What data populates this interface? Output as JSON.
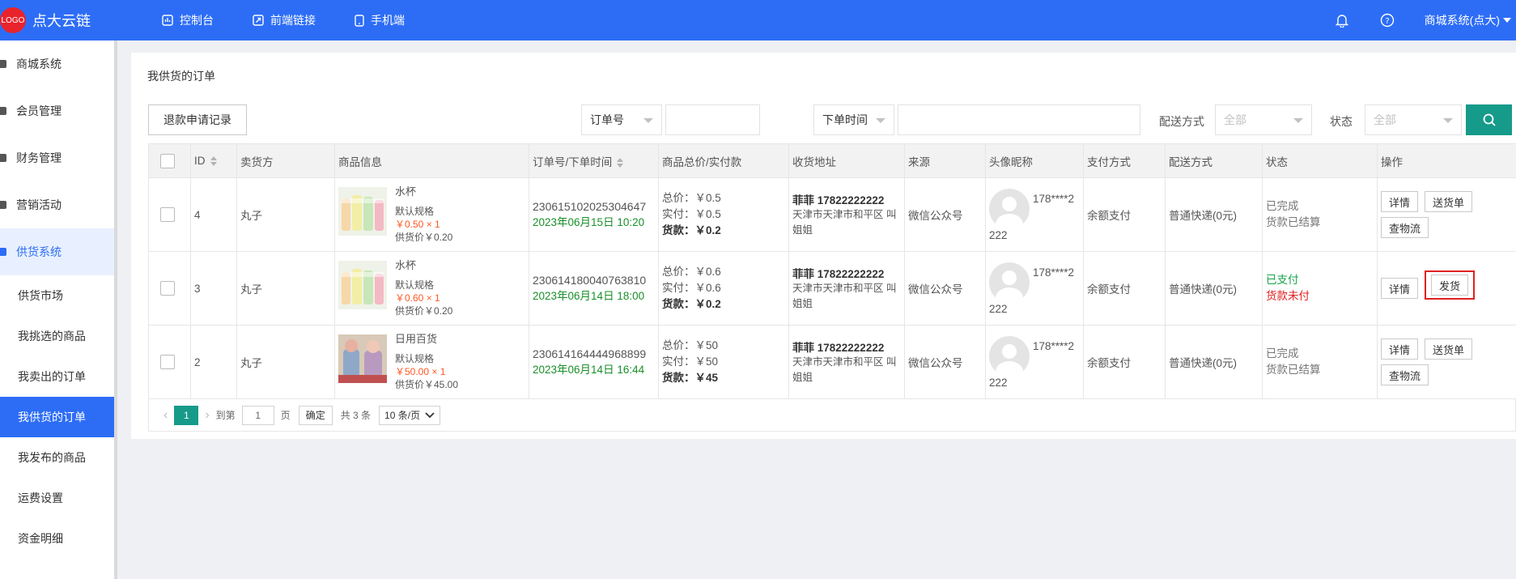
{
  "header": {
    "logo_text": "LOGO",
    "brand": "点大云链",
    "nav": [
      {
        "label": "控制台",
        "icon": "dashboard-icon"
      },
      {
        "label": "前端链接",
        "icon": "link-icon"
      },
      {
        "label": "手机端",
        "icon": "mobile-icon"
      }
    ],
    "user": "商城系统(点大)"
  },
  "sidebar": {
    "groups": [
      {
        "label": "商城系统"
      },
      {
        "label": "会员管理"
      },
      {
        "label": "财务管理"
      },
      {
        "label": "营销活动"
      },
      {
        "label": "供货系统"
      }
    ],
    "subitems": [
      {
        "label": "供货市场"
      },
      {
        "label": "我挑选的商品"
      },
      {
        "label": "我卖出的订单"
      },
      {
        "label": "我供货的订单"
      },
      {
        "label": "我发布的商品"
      },
      {
        "label": "运费设置"
      },
      {
        "label": "资金明细"
      }
    ]
  },
  "panel": {
    "title": "我供货的订单"
  },
  "toolbar": {
    "refund_button": "退款申请记录",
    "order_field_select": "订单号",
    "time_field_select": "下单时间",
    "delivery_label": "配送方式",
    "delivery_select": "全部",
    "status_label": "状态",
    "status_select": "全部"
  },
  "table": {
    "headers": [
      "ID",
      "卖货方",
      "商品信息",
      "订单号/下单时间",
      "商品总价/实付款",
      "收货地址",
      "来源",
      "头像昵称",
      "支付方式",
      "配送方式",
      "状态",
      "操作"
    ],
    "rows": [
      {
        "id": "4",
        "seller": "丸子",
        "product_name": "水杯",
        "spec": "默认规格",
        "price_qty": "￥0.50 × 1",
        "supply_price": "供货价￥0.20",
        "order_no": "230615102025304647",
        "order_time": "2023年06月15日 10:20",
        "total": "总价：￥0.5",
        "paid": "实付：￥0.5",
        "goods": "货款：￥0.2",
        "addr_name": "菲菲 17822222222",
        "addr": "天津市天津市和平区 叫姐姐",
        "source": "微信公众号",
        "nick_a": "178****2",
        "nick_b": "222",
        "pay_method": "余额支付",
        "delivery": "普通快递(0元)",
        "status1": "已完成",
        "status2": "货款已结算",
        "ops": [
          "详情",
          "送货单",
          "查物流"
        ]
      },
      {
        "id": "3",
        "seller": "丸子",
        "product_name": "水杯",
        "spec": "默认规格",
        "price_qty": "￥0.60 × 1",
        "supply_price": "供货价￥0.20",
        "order_no": "230614180040763810",
        "order_time": "2023年06月14日 18:00",
        "total": "总价：￥0.6",
        "paid": "实付：￥0.6",
        "goods": "货款：￥0.2",
        "addr_name": "菲菲 17822222222",
        "addr": "天津市天津市和平区 叫姐姐",
        "source": "微信公众号",
        "nick_a": "178****2",
        "nick_b": "222",
        "pay_method": "余额支付",
        "delivery": "普通快递(0元)",
        "status1": "已支付",
        "status2": "货款未付",
        "ops": [
          "详情",
          "发货"
        ]
      },
      {
        "id": "2",
        "seller": "丸子",
        "product_name": "日用百货",
        "spec": "默认规格",
        "price_qty": "￥50.00 × 1",
        "supply_price": "供货价￥45.00",
        "order_no": "230614164444968899",
        "order_time": "2023年06月14日 16:44",
        "total": "总价：￥50",
        "paid": "实付：￥50",
        "goods": "货款：￥45",
        "addr_name": "菲菲 17822222222",
        "addr": "天津市天津市和平区 叫姐姐",
        "source": "微信公众号",
        "nick_a": "178****2",
        "nick_b": "222",
        "pay_method": "余额支付",
        "delivery": "普通快递(0元)",
        "status1": "已完成",
        "status2": "货款已结算",
        "ops": [
          "详情",
          "送货单",
          "查物流"
        ]
      }
    ]
  },
  "pager": {
    "current_page": "1",
    "goto_label": "到第",
    "goto_value": "1",
    "page_unit": "页",
    "confirm": "确定",
    "total": "共 3 条",
    "page_size": "10 条/页"
  },
  "colors": {
    "primary": "#2d6df6",
    "teal": "#169a8a",
    "red_alert": "#e02020"
  }
}
